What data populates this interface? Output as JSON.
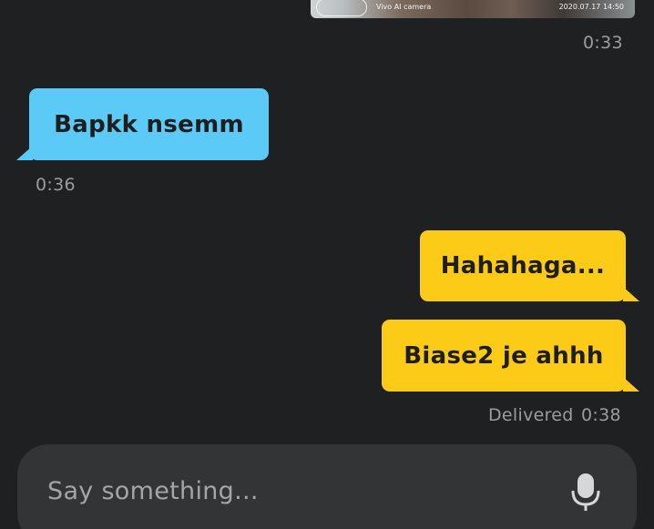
{
  "attachment": {
    "watermark_left": "Vivo AI camera",
    "watermark_right": "2020.07.17 14:50"
  },
  "messages": [
    {
      "direction": "out",
      "kind": "image",
      "time": "0:33"
    },
    {
      "direction": "in",
      "text": "Bapkk nsemm",
      "time": "0:36"
    },
    {
      "direction": "out",
      "text": "Hahahaga..."
    },
    {
      "direction": "out",
      "text": "Biase2 je ahhh",
      "status": "Delivered",
      "time": "0:38"
    }
  ],
  "composer": {
    "placeholder": "Say something...",
    "mic_icon": "microphone-icon"
  },
  "colors": {
    "background": "#1f2021",
    "incoming_bubble": "#5ccaf6",
    "outgoing_bubble": "#fccb17",
    "composer_bg": "#323436",
    "meta_text": "#9a9c9e"
  }
}
